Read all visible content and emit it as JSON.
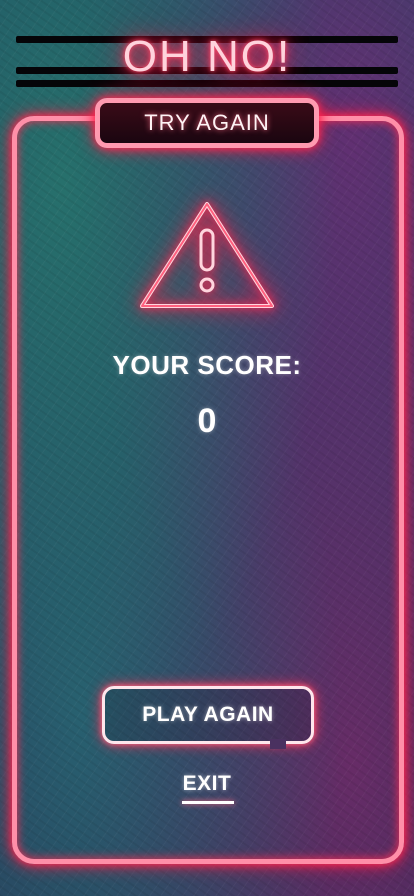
{
  "header": {
    "title": "OH NO!"
  },
  "badge": {
    "label": "TRY AGAIN"
  },
  "icon": {
    "name": "warning-icon",
    "color": "#ff2d55"
  },
  "score": {
    "label": "YOUR SCORE:",
    "value": "0"
  },
  "actions": {
    "play_again": "PLAY AGAIN",
    "exit": "EXIT"
  },
  "colors": {
    "neon_pink": "#ff2d55",
    "neon_soft": "#ff8fa8",
    "text": "#ffffff"
  }
}
